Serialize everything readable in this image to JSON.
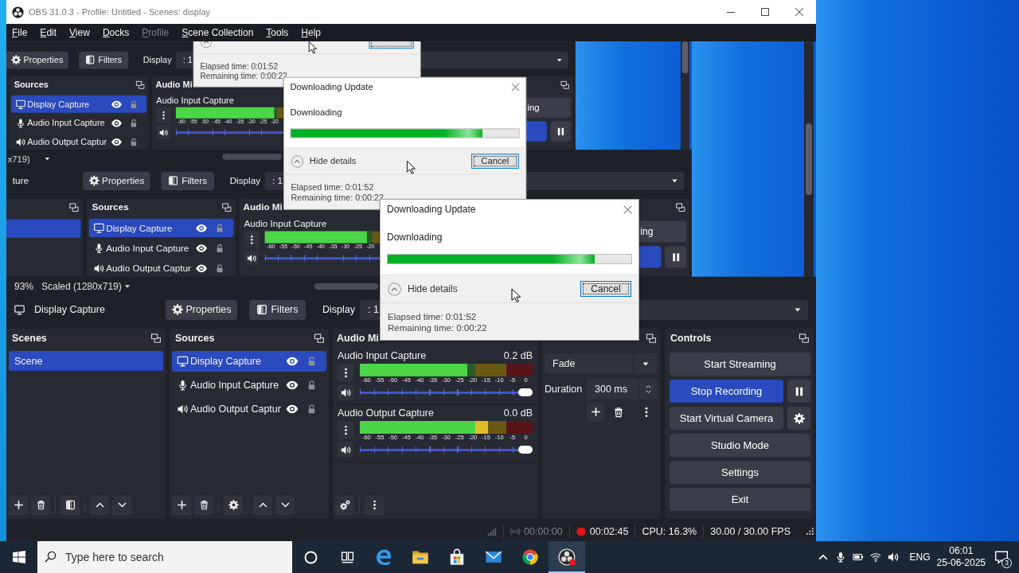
{
  "window": {
    "title": "OBS 31.0.3 - Profile: Untitled - Scenes: display"
  },
  "menu": [
    {
      "label": "File",
      "disabled": false
    },
    {
      "label": "Edit",
      "disabled": false
    },
    {
      "label": "View",
      "disabled": false
    },
    {
      "label": "Docks",
      "disabled": false
    },
    {
      "label": "Profile",
      "disabled": true
    },
    {
      "label": "Scene Collection",
      "disabled": false
    },
    {
      "label": "Tools",
      "disabled": false
    },
    {
      "label": "Help",
      "disabled": false
    }
  ],
  "preview": {
    "screen": {
      "preview": {
        "scale_mode": "x719)",
        "screen": {
          "context_bar": {
            "buttons": [
              {
                "label": "Properties",
                "kind": "properties"
              },
              {
                "label": "Filters",
                "kind": "filters"
              }
            ],
            "display_label": "Display",
            "display_value": ": 1"
          },
          "sources": {
            "title": "Sources",
            "items": [
              {
                "name": "Display Capture",
                "kind": "display",
                "selected": true
              },
              {
                "name": "Audio Input Capture",
                "kind": "mic",
                "selected": false
              },
              {
                "name": "Audio Output Captur",
                "kind": "speaker",
                "selected": false
              }
            ]
          },
          "audio_mixer": {
            "title": "Audio Mi",
            "channels": [
              {
                "name": "Audio Input Capture",
                "level": 0.65,
                "volume": {
                  "level": 1
                },
                "scale": [
                  "-60",
                  "-55",
                  "-50",
                  "-45",
                  "-40",
                  "-35",
                  "-30",
                  "-25",
                  "-20"
                ]
              }
            ]
          },
          "controls": {
            "buttons": [
              {
                "label": "ing",
                "kind": "stream",
                "on": false
              },
              {
                "kind": "record",
                "on": true
              }
            ]
          },
          "dialog": {
            "cancel": {
              "focused": true
            },
            "elapsed": "Elapsed time: 0:01:52",
            "remaining": "Remaining time: 0:00:22"
          }
        }
      },
      "context_bar": {
        "source": "ture",
        "buttons": [
          {
            "label": "Properties",
            "kind": "properties"
          },
          {
            "label": "Filters",
            "kind": "filters"
          }
        ],
        "display_label": "Display",
        "display_value": ": 1"
      },
      "scenes": {
        "items": [
          {
            "selected": true
          }
        ]
      },
      "sources": {
        "title": "Sources",
        "items": [
          {
            "name": "Display Capture",
            "kind": "display",
            "selected": true
          },
          {
            "name": "Audio Input Capture",
            "kind": "mic",
            "selected": false
          },
          {
            "name": "Audio Output Captur",
            "kind": "speaker",
            "selected": false
          }
        ]
      },
      "audio_mixer": {
        "title": "Audio Mi",
        "channels": [
          {
            "name": "Audio Input Capture",
            "level": 0.63,
            "volume": {
              "level": 1
            },
            "scale": [
              "-60",
              "-55",
              "-50",
              "-45",
              "-40",
              "-35",
              "-30",
              "-25",
              "-20"
            ]
          }
        ]
      },
      "controls": {
        "buttons": [
          {
            "label": "ing",
            "kind": "stream",
            "on": false
          },
          {
            "kind": "record",
            "on": true
          }
        ]
      },
      "dialog": {
        "title": "Downloading Update",
        "status": "Downloading",
        "level": 0.84,
        "toggle": "Hide details",
        "cancel": {
          "label": "Cancel",
          "focused": true
        },
        "elapsed": "Elapsed time: 0:01:52",
        "remaining": "Remaining time: 0:00:22"
      }
    },
    "zoom": "93%",
    "scale_mode": "Scaled (1280x719)"
  },
  "context_bar": {
    "source": "Display Capture",
    "buttons": [
      {
        "label": "Properties",
        "kind": "properties"
      },
      {
        "label": "Filters",
        "kind": "filters"
      }
    ],
    "display_label": "Display",
    "display_value": ": 1"
  },
  "scenes": {
    "title": "Scenes",
    "items": [
      {
        "name": "Scene",
        "selected": true
      }
    ]
  },
  "sources": {
    "title": "Sources",
    "items": [
      {
        "name": "Display Capture",
        "kind": "display",
        "selected": true
      },
      {
        "name": "Audio Input Capture",
        "kind": "mic",
        "selected": false
      },
      {
        "name": "Audio Output Captur",
        "kind": "speaker",
        "selected": false
      }
    ]
  },
  "audio_mixer": {
    "title": "Audio Mi",
    "channels": [
      {
        "name": "Audio Input Capture",
        "reading": "0.2 dB",
        "level": 0.62,
        "volume": {
          "level": 1
        },
        "scale": [
          "-60",
          "-55",
          "-50",
          "-45",
          "-40",
          "-35",
          "-30",
          "-25",
          "-20",
          "-15",
          "-10",
          "-5",
          "0"
        ]
      },
      {
        "name": "Audio Output Capture",
        "reading": "0.0 dB",
        "level": 0.74,
        "volume": {
          "level": 1
        },
        "scale": [
          "-60",
          "-55",
          "-50",
          "-45",
          "-40",
          "-35",
          "-30",
          "-25",
          "-20",
          "-15",
          "-10",
          "-5",
          "0"
        ]
      }
    ]
  },
  "transitions": {
    "transition": "Fade",
    "duration_label": "Duration",
    "duration": "300 ms"
  },
  "controls": {
    "title": "Controls",
    "buttons": [
      {
        "label": "Start Streaming",
        "kind": "stream",
        "on": false
      },
      {
        "label": "Stop Recording",
        "kind": "record",
        "on": true
      },
      {
        "label": "Start Virtual Camera",
        "kind": "virtual_camera",
        "on": false
      },
      {
        "label": "Studio Mode",
        "kind": "studio_mode",
        "on": false
      },
      {
        "label": "Settings",
        "kind": "settings",
        "on": false
      },
      {
        "label": "Exit",
        "kind": "exit",
        "on": false
      }
    ]
  },
  "status_bar": {
    "streaming": {
      "time": "00:00:00",
      "active": false
    },
    "recording": {
      "time": "00:02:45",
      "active": true
    },
    "cpu": "CPU: 16.3%",
    "fps": "30.00 / 30.00 FPS"
  },
  "dialog": {
    "title": "Downloading Update",
    "status": "Downloading",
    "level": 0.85,
    "toggle": "Hide details",
    "cancel": {
      "label": "Cancel",
      "focused": true
    },
    "elapsed": "Elapsed time: 0:01:52",
    "remaining": "Remaining time: 0:00:22"
  },
  "taskbar": {
    "search": {
      "placeholder": "Type here to search"
    },
    "apps": [
      {
        "kind": "cortana",
        "active": false
      },
      {
        "kind": "task_view",
        "active": false
      },
      {
        "kind": "edge",
        "active": false
      },
      {
        "kind": "explorer",
        "active": false
      },
      {
        "kind": "store",
        "active": false
      },
      {
        "kind": "mail",
        "active": false
      },
      {
        "kind": "chrome",
        "active": false
      },
      {
        "kind": "obs",
        "active": true
      }
    ],
    "tray": {
      "language": "ENG",
      "time": "06:01",
      "date": "25-06-2025",
      "notifications": "3"
    }
  }
}
